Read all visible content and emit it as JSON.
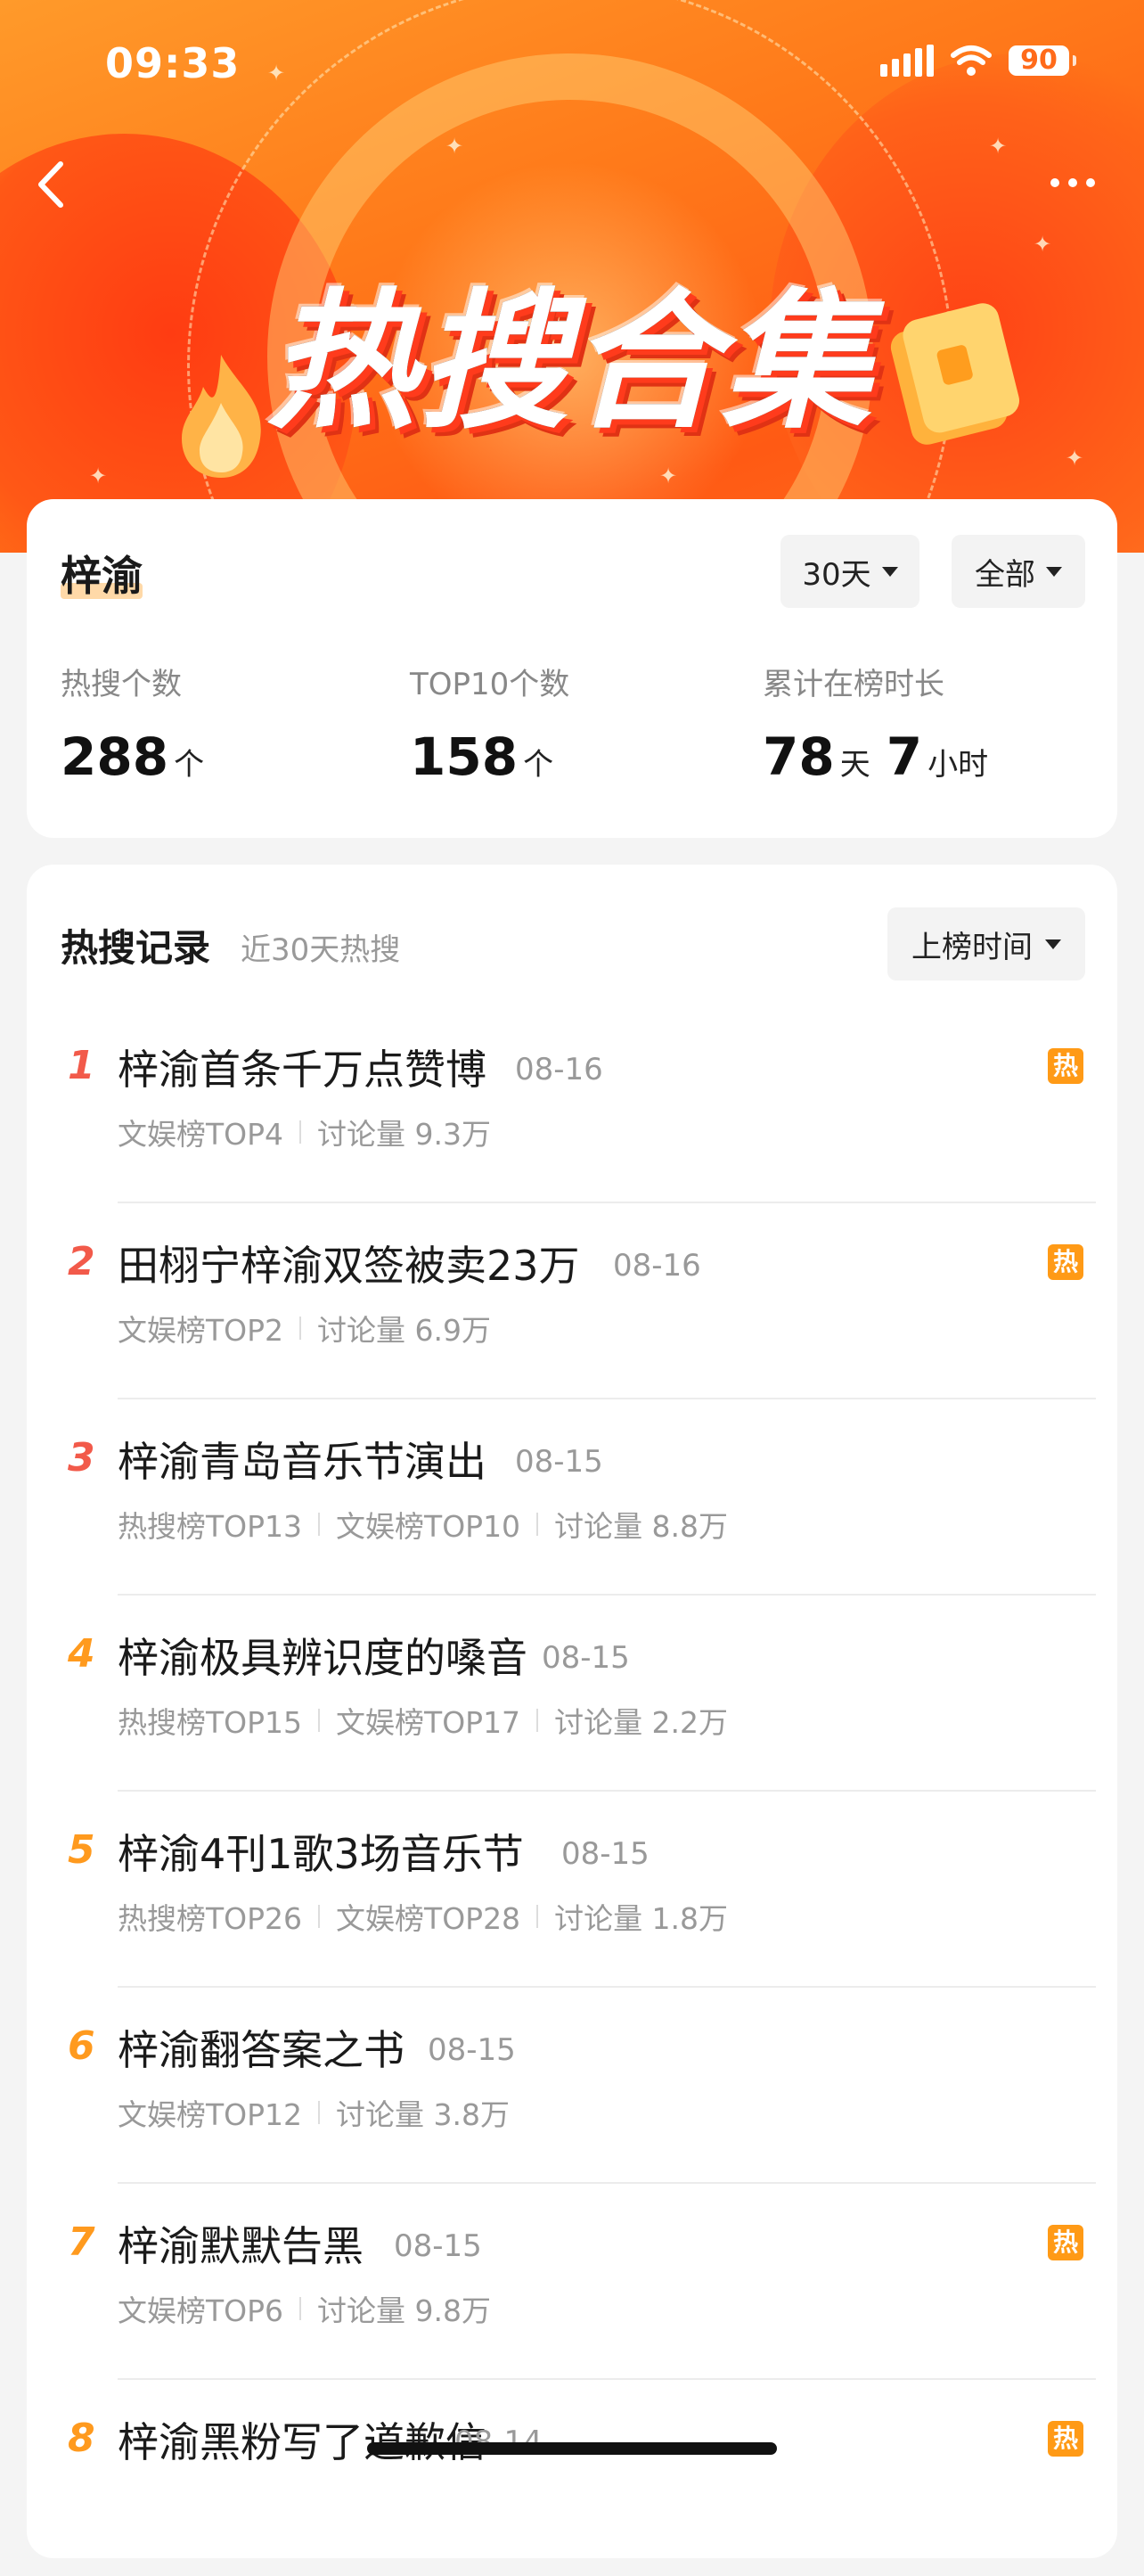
{
  "status_bar": {
    "time": "09:33",
    "battery": "90"
  },
  "header": {
    "title": "热搜合集"
  },
  "summary": {
    "name": "梓渝",
    "period_filter": "30天",
    "scope_filter": "全部",
    "stats": [
      {
        "label": "热搜个数",
        "value": "288",
        "unit": "个"
      },
      {
        "label": "TOP10个数",
        "value": "158",
        "unit": "个"
      },
      {
        "label": "累计在榜时长",
        "value1": "78",
        "unit1": "天",
        "value2": "7",
        "unit2": "小时"
      }
    ]
  },
  "records": {
    "title": "热搜记录",
    "subtitle": "近30天热搜",
    "sort_label": "上榜时间",
    "items": [
      {
        "rank": "1",
        "topic": "梓渝首条千万点赞博",
        "date": "08-16",
        "meta": [
          "文娱榜TOP4",
          "讨论量 9.3万"
        ],
        "hot": "热",
        "rank_color": "#f25a4a"
      },
      {
        "rank": "2",
        "topic": "田栩宁梓渝双签被卖23万",
        "date": "08-16",
        "meta": [
          "文娱榜TOP2",
          "讨论量 6.9万"
        ],
        "hot": "热",
        "rank_color": "#f25a4a"
      },
      {
        "rank": "3",
        "topic": "梓渝青岛音乐节演出",
        "date": "08-15",
        "meta": [
          "热搜榜TOP13",
          "文娱榜TOP10",
          "讨论量 8.8万"
        ],
        "hot": "",
        "rank_color": "#f25a4a"
      },
      {
        "rank": "4",
        "topic": "梓渝极具辨识度的嗓音",
        "date": "08-15",
        "meta": [
          "热搜榜TOP15",
          "文娱榜TOP17",
          "讨论量 2.2万"
        ],
        "hot": "",
        "rank_color": "#ff9a1e"
      },
      {
        "rank": "5",
        "topic": "梓渝4刊1歌3场音乐节",
        "date": "08-15",
        "meta": [
          "热搜榜TOP26",
          "文娱榜TOP28",
          "讨论量 1.8万"
        ],
        "hot": "",
        "rank_color": "#ff9a1e"
      },
      {
        "rank": "6",
        "topic": "梓渝翻答案之书",
        "date": "08-15",
        "meta": [
          "文娱榜TOP12",
          "讨论量 3.8万"
        ],
        "hot": "",
        "rank_color": "#ff9a1e"
      },
      {
        "rank": "7",
        "topic": "梓渝默默告黑",
        "date": "08-15",
        "meta": [
          "文娱榜TOP6",
          "讨论量 9.8万"
        ],
        "hot": "热",
        "rank_color": "#ff9a1e"
      },
      {
        "rank": "8",
        "topic": "梓渝黑粉写了道歉信",
        "date": "08-14",
        "meta": [],
        "hot": "热",
        "rank_color": "#ff9a1e"
      }
    ]
  }
}
